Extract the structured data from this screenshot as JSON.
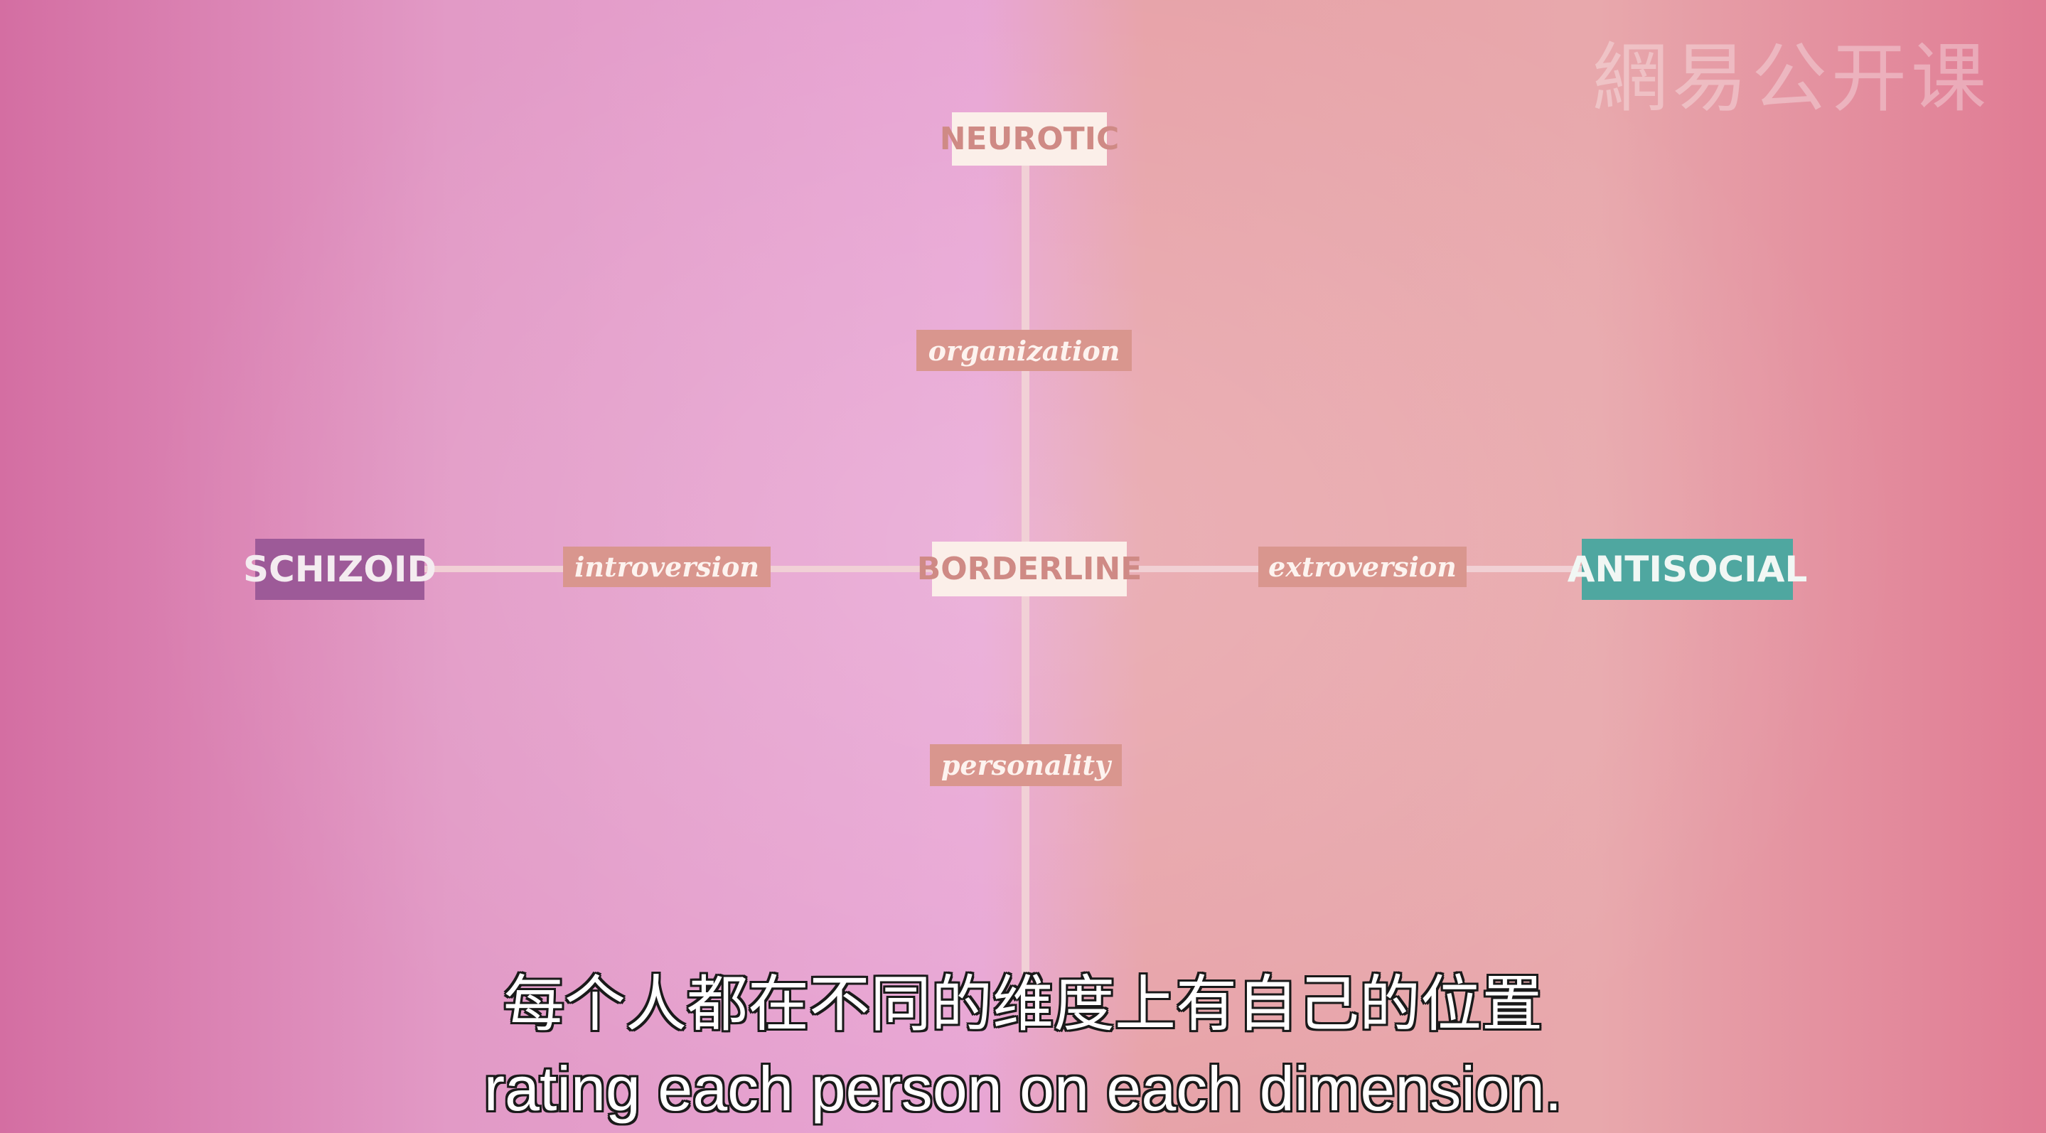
{
  "watermark": "網易公开课",
  "diagram": {
    "nodes": {
      "top": "NEUROTIC",
      "center": "BORDERLINE",
      "left": "SCHIZOID",
      "right": "ANTISOCIAL"
    },
    "dimensions": {
      "vertical_upper": "organization",
      "vertical_lower": "personality",
      "horizontal_left": "introversion",
      "horizontal_right": "extroversion"
    },
    "colors": {
      "schizoid": "#9d5a98",
      "antisocial": "#4fa7a0",
      "light_box": "#fbefe9",
      "dimension_box": "#d9968e"
    }
  },
  "subtitles": {
    "zh": "每个人都在不同的维度上有自己的位置",
    "en": "rating each person on each dimension."
  }
}
